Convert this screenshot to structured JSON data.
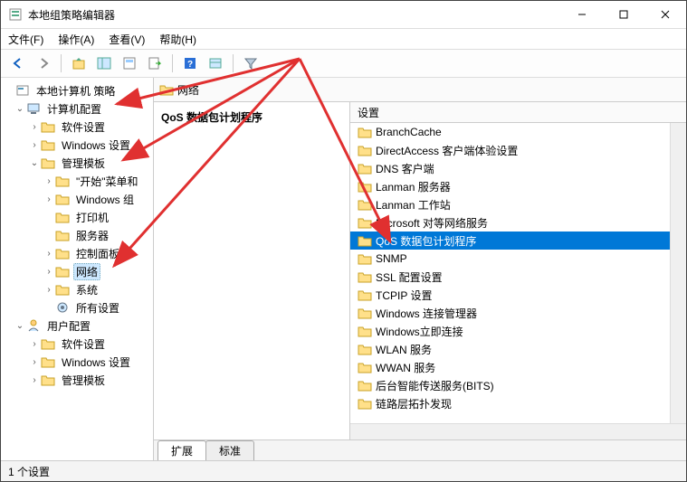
{
  "window": {
    "title": "本地组策略编辑器"
  },
  "menubar": [
    "文件(F)",
    "操作(A)",
    "查看(V)",
    "帮助(H)"
  ],
  "tree": {
    "root": "本地计算机 策略",
    "computer_cfg": "计算机配置",
    "soft_settings": "软件设置",
    "win_settings": "Windows 设置",
    "admin_tpl": "管理模板",
    "start_menu": "\"开始\"菜单和",
    "win_comp": "Windows 组",
    "printers": "打印机",
    "servers": "服务器",
    "ctrl_panel": "控制面板",
    "network": "网络",
    "system": "系统",
    "all_settings": "所有设置",
    "user_cfg": "用户配置",
    "u_soft": "软件设置",
    "u_win": "Windows 设置",
    "u_admin": "管理模板"
  },
  "path": {
    "label": "网络"
  },
  "detail": {
    "heading": "QoS 数据包计划程序"
  },
  "list": {
    "header": "设置",
    "items": [
      "BranchCache",
      "DirectAccess 客户端体验设置",
      "DNS 客户端",
      "Lanman 服务器",
      "Lanman 工作站",
      "Microsoft 对等网络服务",
      "QoS 数据包计划程序",
      "SNMP",
      "SSL 配置设置",
      "TCPIP 设置",
      "Windows 连接管理器",
      "Windows立即连接",
      "WLAN 服务",
      "WWAN 服务",
      "后台智能传送服务(BITS)",
      "链路层拓扑发现"
    ],
    "selected_index": 6
  },
  "tabs": {
    "extended": "扩展",
    "standard": "标准"
  },
  "status": {
    "text": "1 个设置"
  }
}
